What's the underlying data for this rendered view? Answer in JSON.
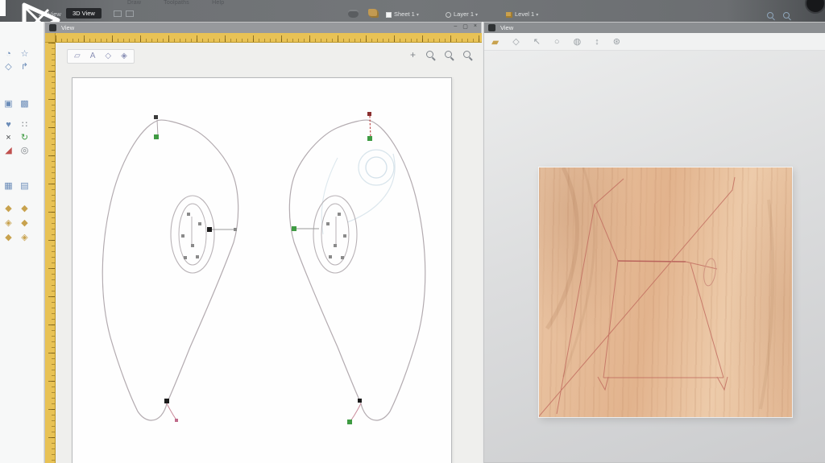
{
  "menubar": {
    "items": [
      "Draw",
      "Toolpaths",
      "Help"
    ]
  },
  "topbar": {
    "view_2d_label": "2D View",
    "view_3d_label": "3D View",
    "sheet_selector": "Sheet 1",
    "layer_selector": "Layer 1",
    "level_selector": "Level 1",
    "caret": "▾"
  },
  "window_2d": {
    "title": "View",
    "buttons": {
      "minimize": "–",
      "restore": "▢",
      "close": "×"
    },
    "toolbar_icons": [
      {
        "name": "layers-tool",
        "glyph": "▱"
      },
      {
        "name": "text-select-tool",
        "glyph": "A"
      },
      {
        "name": "node-edit-tool",
        "glyph": "◇"
      },
      {
        "name": "snap-tool",
        "glyph": "◈"
      }
    ],
    "zoom_plus": "+"
  },
  "window_3d": {
    "title": "View",
    "icons": [
      {
        "name": "material",
        "glyph": "▰"
      },
      {
        "name": "wireframe",
        "glyph": "◇"
      },
      {
        "name": "select",
        "glyph": "↖"
      },
      {
        "name": "circle",
        "glyph": "○"
      },
      {
        "name": "shaded",
        "glyph": "◍"
      },
      {
        "name": "pan",
        "glyph": "↕"
      },
      {
        "name": "settings",
        "glyph": "⊛"
      }
    ]
  },
  "left_toolbar": {
    "icons": [
      {
        "name": "draw-arc",
        "glyph": "◔"
      },
      {
        "name": "draw-star",
        "glyph": "☆"
      },
      {
        "name": "draw-polygon",
        "glyph": "◇"
      },
      {
        "name": "draw-curve",
        "glyph": "↱"
      },
      {
        "name": "bitmap",
        "glyph": "▣"
      },
      {
        "name": "crop",
        "glyph": "▩"
      },
      {
        "name": "join-vectors",
        "glyph": "♥"
      },
      {
        "name": "measure",
        "glyph": "∷"
      },
      {
        "name": "delete",
        "glyph": "×"
      },
      {
        "name": "refresh",
        "glyph": "↻"
      },
      {
        "name": "fillet",
        "glyph": "◢"
      },
      {
        "name": "offset",
        "glyph": "◎"
      },
      {
        "name": "array-copy",
        "glyph": "▦"
      },
      {
        "name": "mirror",
        "glyph": "▤"
      },
      {
        "name": "clipart-1",
        "glyph": "◆"
      },
      {
        "name": "clipart-2",
        "glyph": "◆"
      },
      {
        "name": "clipart-3",
        "glyph": "◈"
      },
      {
        "name": "clipart-4",
        "glyph": "◆"
      },
      {
        "name": "clipart-5",
        "glyph": "◆"
      },
      {
        "name": "clipart-6",
        "glyph": "◈"
      }
    ]
  },
  "colors": {
    "ruler_gold": "#e8c255",
    "wood_base": "#e4b997",
    "toolpath_red": "#c06a5e",
    "node_green": "#3f9b43",
    "node_black": "#1c1c1c",
    "leaf_stroke": "#b3abb0",
    "faint_blue": "#d3e1ea",
    "badge_dark": "#26282b"
  }
}
